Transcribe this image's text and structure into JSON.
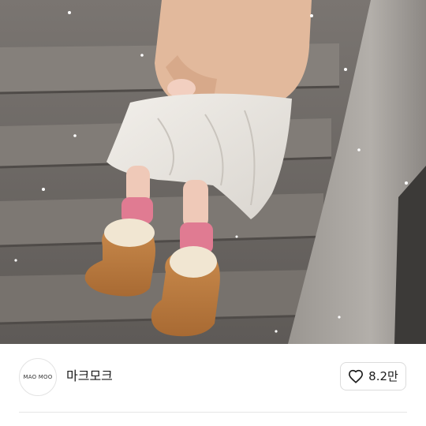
{
  "photo": {
    "alt_subject": "product-lifestyle-photo"
  },
  "brand": {
    "logo_text": "MAO MOO",
    "name": "마크모크"
  },
  "like": {
    "icon": "heart-outline-icon",
    "count": "8.2만"
  },
  "colors": {
    "text": "#1b1b1b",
    "border": "#dcdcdc",
    "divider": "#e6e6e6"
  }
}
